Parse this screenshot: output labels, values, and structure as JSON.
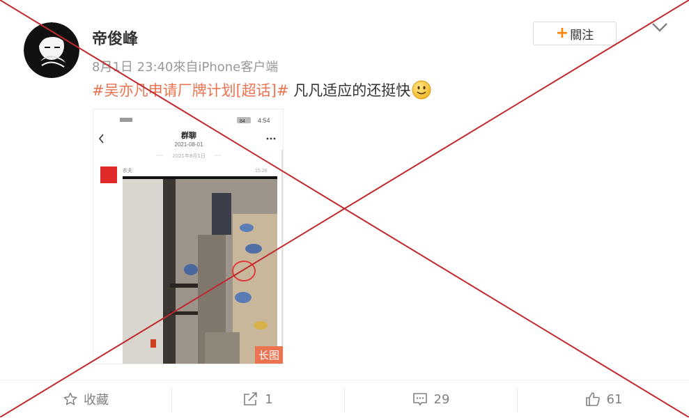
{
  "post": {
    "username": "帝俊峰",
    "meta": "8月1日 23:40來自iPhone客户端",
    "topic": "#吴亦凡申请厂牌计划[超话]#",
    "text": " 凡凡适应的还挺快",
    "emoji": "smile-emoji"
  },
  "follow": {
    "label": "關注"
  },
  "image": {
    "long_tag": "长图",
    "status_time": "4:54",
    "status_battery": "84",
    "chat_title": "群聊",
    "chat_date": "2021-08-01",
    "chat_day": "2021年8月1日",
    "sender": "农夫",
    "msg_time": "15:28"
  },
  "actions": {
    "collect_label": "收藏",
    "share_count": "1",
    "comment_count": "29",
    "like_count": "61"
  },
  "colors": {
    "topic": "#eb7350",
    "follow_plus": "#ff8200",
    "overlay": "#c0282d"
  }
}
